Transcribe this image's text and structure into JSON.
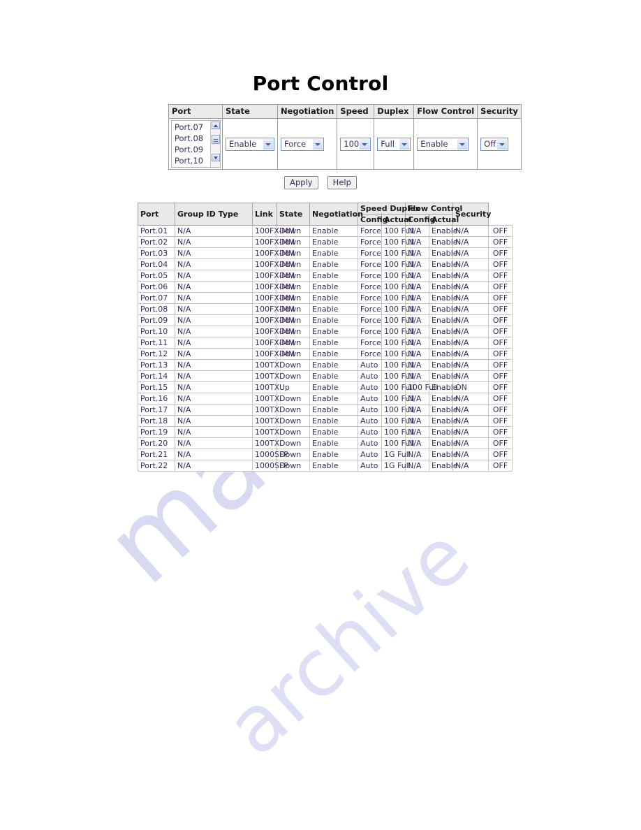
{
  "page": {
    "title": "Port Control",
    "watermark_1": "manuals",
    "watermark_2": "archive"
  },
  "config_form": {
    "headers": {
      "port": "Port",
      "state": "State",
      "negotiation": "Negotiation",
      "speed": "Speed",
      "duplex": "Duplex",
      "flow_control": "Flow Control",
      "security": "Security"
    },
    "port_list": {
      "visible_items": [
        "Port.07",
        "Port.08",
        "Port.09",
        "Port.10"
      ],
      "scroll_up_icon": "scroll-up-arrow-icon",
      "scroll_down_icon": "scroll-down-arrow-icon",
      "scroll_thumb": "scrollbar-thumb"
    },
    "selects": {
      "state": "Enable",
      "negotiation": "Force",
      "speed": "100",
      "duplex": "Full",
      "flow_control": "Enable",
      "security": "Off"
    },
    "dropdown_icon": "chevron-down-icon"
  },
  "buttons": {
    "apply": "Apply",
    "help": "Help"
  },
  "status_table": {
    "headers": {
      "port": "Port",
      "group_id": "Group ID",
      "type": "Type",
      "link": "Link",
      "state": "State",
      "negotiation": "Negotiation",
      "speed_duplex": "Speed Duplex",
      "speed_config": "Config",
      "speed_actual": "Actual",
      "flow_control": "Flow Control",
      "flow_config": "Config",
      "flow_actual": "Actual",
      "security": "Security"
    },
    "rows": [
      {
        "port": "Port.01",
        "group_id": "N/A",
        "type": "100FX-MM",
        "link": "Down",
        "state": "Enable",
        "negotiation": "Force",
        "speed_config": "100 Full",
        "speed_actual": "N/A",
        "flow_config": "Enable",
        "flow_actual": "N/A",
        "security": "OFF"
      },
      {
        "port": "Port.02",
        "group_id": "N/A",
        "type": "100FX-MM",
        "link": "Down",
        "state": "Enable",
        "negotiation": "Force",
        "speed_config": "100 Full",
        "speed_actual": "N/A",
        "flow_config": "Enable",
        "flow_actual": "N/A",
        "security": "OFF"
      },
      {
        "port": "Port.03",
        "group_id": "N/A",
        "type": "100FX-MM",
        "link": "Down",
        "state": "Enable",
        "negotiation": "Force",
        "speed_config": "100 Full",
        "speed_actual": "N/A",
        "flow_config": "Enable",
        "flow_actual": "N/A",
        "security": "OFF"
      },
      {
        "port": "Port.04",
        "group_id": "N/A",
        "type": "100FX-MM",
        "link": "Down",
        "state": "Enable",
        "negotiation": "Force",
        "speed_config": "100 Full",
        "speed_actual": "N/A",
        "flow_config": "Enable",
        "flow_actual": "N/A",
        "security": "OFF"
      },
      {
        "port": "Port.05",
        "group_id": "N/A",
        "type": "100FX-MM",
        "link": "Down",
        "state": "Enable",
        "negotiation": "Force",
        "speed_config": "100 Full",
        "speed_actual": "N/A",
        "flow_config": "Enable",
        "flow_actual": "N/A",
        "security": "OFF"
      },
      {
        "port": "Port.06",
        "group_id": "N/A",
        "type": "100FX-MM",
        "link": "Down",
        "state": "Enable",
        "negotiation": "Force",
        "speed_config": "100 Full",
        "speed_actual": "N/A",
        "flow_config": "Enable",
        "flow_actual": "N/A",
        "security": "OFF"
      },
      {
        "port": "Port.07",
        "group_id": "N/A",
        "type": "100FX-MM",
        "link": "Down",
        "state": "Enable",
        "negotiation": "Force",
        "speed_config": "100 Full",
        "speed_actual": "N/A",
        "flow_config": "Enable",
        "flow_actual": "N/A",
        "security": "OFF"
      },
      {
        "port": "Port.08",
        "group_id": "N/A",
        "type": "100FX-MM",
        "link": "Down",
        "state": "Enable",
        "negotiation": "Force",
        "speed_config": "100 Full",
        "speed_actual": "N/A",
        "flow_config": "Enable",
        "flow_actual": "N/A",
        "security": "OFF"
      },
      {
        "port": "Port.09",
        "group_id": "N/A",
        "type": "100FX-MM",
        "link": "Down",
        "state": "Enable",
        "negotiation": "Force",
        "speed_config": "100 Full",
        "speed_actual": "N/A",
        "flow_config": "Enable",
        "flow_actual": "N/A",
        "security": "OFF"
      },
      {
        "port": "Port.10",
        "group_id": "N/A",
        "type": "100FX-MM",
        "link": "Down",
        "state": "Enable",
        "negotiation": "Force",
        "speed_config": "100 Full",
        "speed_actual": "N/A",
        "flow_config": "Enable",
        "flow_actual": "N/A",
        "security": "OFF"
      },
      {
        "port": "Port.11",
        "group_id": "N/A",
        "type": "100FX-MM",
        "link": "Down",
        "state": "Enable",
        "negotiation": "Force",
        "speed_config": "100 Full",
        "speed_actual": "N/A",
        "flow_config": "Enable",
        "flow_actual": "N/A",
        "security": "OFF"
      },
      {
        "port": "Port.12",
        "group_id": "N/A",
        "type": "100FX-MM",
        "link": "Down",
        "state": "Enable",
        "negotiation": "Force",
        "speed_config": "100 Full",
        "speed_actual": "N/A",
        "flow_config": "Enable",
        "flow_actual": "N/A",
        "security": "OFF"
      },
      {
        "port": "Port.13",
        "group_id": "N/A",
        "type": "100TX",
        "link": "Down",
        "state": "Enable",
        "negotiation": "Auto",
        "speed_config": "100 Full",
        "speed_actual": "N/A",
        "flow_config": "Enable",
        "flow_actual": "N/A",
        "security": "OFF"
      },
      {
        "port": "Port.14",
        "group_id": "N/A",
        "type": "100TX",
        "link": "Down",
        "state": "Enable",
        "negotiation": "Auto",
        "speed_config": "100 Full",
        "speed_actual": "N/A",
        "flow_config": "Enable",
        "flow_actual": "N/A",
        "security": "OFF"
      },
      {
        "port": "Port.15",
        "group_id": "N/A",
        "type": "100TX",
        "link": "Up",
        "state": "Enable",
        "negotiation": "Auto",
        "speed_config": "100 Full",
        "speed_actual": "100 Full",
        "flow_config": "Enable",
        "flow_actual": "ON",
        "security": "OFF"
      },
      {
        "port": "Port.16",
        "group_id": "N/A",
        "type": "100TX",
        "link": "Down",
        "state": "Enable",
        "negotiation": "Auto",
        "speed_config": "100 Full",
        "speed_actual": "N/A",
        "flow_config": "Enable",
        "flow_actual": "N/A",
        "security": "OFF"
      },
      {
        "port": "Port.17",
        "group_id": "N/A",
        "type": "100TX",
        "link": "Down",
        "state": "Enable",
        "negotiation": "Auto",
        "speed_config": "100 Full",
        "speed_actual": "N/A",
        "flow_config": "Enable",
        "flow_actual": "N/A",
        "security": "OFF"
      },
      {
        "port": "Port.18",
        "group_id": "N/A",
        "type": "100TX",
        "link": "Down",
        "state": "Enable",
        "negotiation": "Auto",
        "speed_config": "100 Full",
        "speed_actual": "N/A",
        "flow_config": "Enable",
        "flow_actual": "N/A",
        "security": "OFF"
      },
      {
        "port": "Port.19",
        "group_id": "N/A",
        "type": "100TX",
        "link": "Down",
        "state": "Enable",
        "negotiation": "Auto",
        "speed_config": "100 Full",
        "speed_actual": "N/A",
        "flow_config": "Enable",
        "flow_actual": "N/A",
        "security": "OFF"
      },
      {
        "port": "Port.20",
        "group_id": "N/A",
        "type": "100TX",
        "link": "Down",
        "state": "Enable",
        "negotiation": "Auto",
        "speed_config": "100 Full",
        "speed_actual": "N/A",
        "flow_config": "Enable",
        "flow_actual": "N/A",
        "security": "OFF"
      },
      {
        "port": "Port.21",
        "group_id": "N/A",
        "type": "1000SFP",
        "link": "Down",
        "state": "Enable",
        "negotiation": "Auto",
        "speed_config": "1G Full",
        "speed_actual": "N/A",
        "flow_config": "Enable",
        "flow_actual": "N/A",
        "security": "OFF"
      },
      {
        "port": "Port.22",
        "group_id": "N/A",
        "type": "1000SFP",
        "link": "Down",
        "state": "Enable",
        "negotiation": "Auto",
        "speed_config": "1G Full",
        "speed_actual": "N/A",
        "flow_config": "Enable",
        "flow_actual": "N/A",
        "security": "OFF"
      }
    ]
  }
}
